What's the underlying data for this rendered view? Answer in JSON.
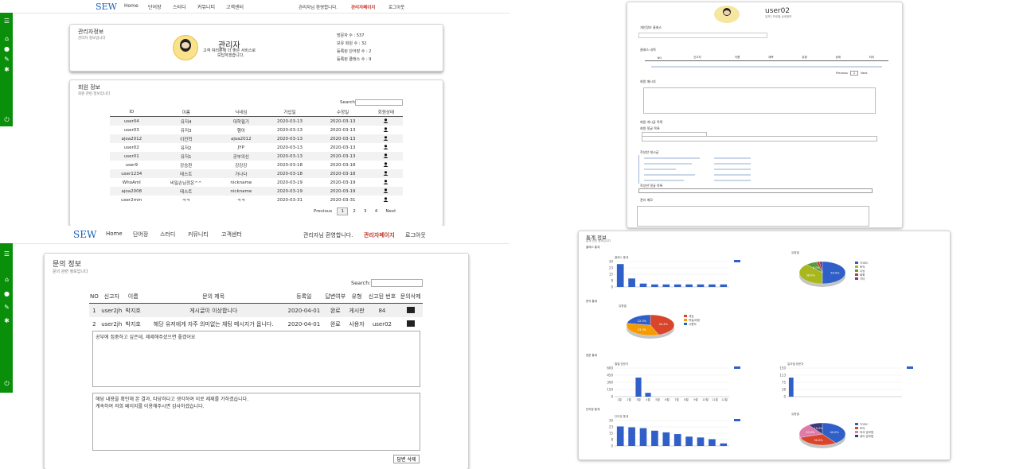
{
  "panel1": {
    "brand": "SEW",
    "nav": [
      "Home",
      "단어장",
      "스터디",
      "커뮤니티",
      "고객센터"
    ],
    "greeting": "관리자님 환영합니다.",
    "admin_link": "관리자페이지",
    "logout": "로그아웃",
    "admin_card": {
      "title": "관리자정보",
      "subtitle": "관리자 정보입니다",
      "name": "관리자",
      "message1": "고객 여러분께 더 좋은 서비스로",
      "message2": "보답하겠습니다.",
      "stats": [
        "방문자 수 : 537",
        "보유 회원 수 : 32",
        "등록된 단어장 수 : 2",
        "등록된 클래스 수 : 9"
      ]
    },
    "members": {
      "title": "회원 정보",
      "subtitle": "회원 관련 정보입니다",
      "search_label": "Search:",
      "columns": [
        "ID",
        "이름",
        "닉네임",
        "가입일",
        "수정일",
        "회원상태"
      ],
      "rows": [
        [
          "user04",
          "유저4",
          "대학필기",
          "2020-03-13",
          "2020-03-13"
        ],
        [
          "user03",
          "유저3",
          "행아",
          "2020-03-13",
          "2020-03-13"
        ],
        [
          "ajoa2012",
          "이진혁",
          "ajoa2012",
          "2020-03-13",
          "2020-03-13"
        ],
        [
          "user02",
          "유저2",
          "JYP",
          "2020-03-13",
          "2020-03-13"
        ],
        [
          "user01",
          "유저1",
          "공부의신",
          "2020-03-13",
          "2020-03-13"
        ],
        [
          "user9",
          "강승환",
          "강강강",
          "2020-03-18",
          "2020-03-18"
        ],
        [
          "user1234",
          "테스트",
          "가나다",
          "2020-03-18",
          "2020-03-18"
        ],
        [
          "WhoAmI",
          "비밀손님정온^^",
          "nickname",
          "2020-03-19",
          "2020-03-19"
        ],
        [
          "ajoa2008",
          "테스트",
          "nickname",
          "2020-03-19",
          "2020-03-19"
        ],
        [
          "user2mm",
          "ㅋㅋ",
          "ㅋㅋ",
          "2020-03-31",
          "2020-03-31"
        ]
      ],
      "pagination": [
        "Previous",
        "1",
        "2",
        "3",
        "4",
        "Next"
      ]
    }
  },
  "panel2": {
    "username": "user02",
    "user_sub": "유저2 프로필 상세정보",
    "sections": [
      "개인정보 클래스",
      "클래스 내역",
      "회원 메시지",
      "회원 게시글 목록",
      "회원 댓글 목록",
      "작성한 게시글",
      "작성한 댓글 목록",
      "관리 메모"
    ],
    "table_cols": [
      "NO",
      "신고자",
      "이름",
      "제목",
      "유형",
      "상태",
      "처리"
    ],
    "pager": [
      "Previous",
      "1",
      "Next"
    ]
  },
  "panel3": {
    "brand": "SEW",
    "nav": [
      "Home",
      "단어장",
      "스터디",
      "커뮤니티",
      "고객센터"
    ],
    "greeting": "관리자님 환영합니다.",
    "admin_link": "관리자페이지",
    "logout": "로그아웃",
    "inquiry": {
      "title": "문의 정보",
      "subtitle": "문의 관련 정보입니다",
      "search_label": "Search:",
      "columns": [
        "NO",
        "신고자",
        "이름",
        "문의 제목",
        "등록일",
        "답변여부",
        "유형",
        "신고된 번호",
        "문의삭제"
      ],
      "rows": [
        [
          "1",
          "user2jh",
          "박지호",
          "게시글이 이상합니다",
          "2020-04-01",
          "완료",
          "게시판",
          "84"
        ],
        [
          "2",
          "user2jh",
          "박지호",
          "해당 유저에게 자주 의미없는 채팅 메시지가 옵니다.",
          "2020-04-01",
          "완료",
          "사용자",
          "user02"
        ]
      ],
      "question_text": "공부에 집중하고 싶은데, 제제해주셨으면 좋겠어요",
      "answer_line1": "해당 내용을 확인해 본 결과, 타당하다고 생각하여 이로 제제를 가하겠습니다.",
      "answer_line2": "계속하여 저희 페이지를 이용해주시면 감사하겠습니다.",
      "delete_answer": "답변 삭제"
    }
  },
  "panel4": {
    "title": "통계 정보",
    "subtitle": "통계 관련 정보입니다",
    "sections": [
      "클래스 통계",
      "문의 통계",
      "방문 통계",
      "단어장 통계"
    ],
    "pie_title": "유형별",
    "legend_series": "클래스"
  },
  "chart_data": [
    {
      "type": "bar",
      "title": "클래스 통계",
      "values": [
        27,
        10,
        4,
        3,
        3,
        3,
        3,
        3,
        3,
        3
      ],
      "ylim": [
        0,
        30
      ]
    },
    {
      "type": "pie",
      "title": "유형별",
      "legend": [
        "TOEIC",
        "토익",
        "수능",
        "회화",
        "기타"
      ],
      "values": [
        50.0,
        38.0,
        8.0,
        2.0,
        2.0
      ],
      "colors": [
        "#2f5fc7",
        "#a8b81c",
        "#5a9a3a",
        "#c23a2a",
        "#6a3a8a"
      ]
    },
    {
      "type": "pie",
      "title": "유형별",
      "legend": [
        "게임",
        "욕설/비방",
        "사용자"
      ],
      "values": [
        44.4,
        33.3,
        22.3
      ],
      "colors": [
        "#d9452a",
        "#f59b00",
        "#2f5fc7"
      ]
    },
    {
      "type": "bar",
      "title": "월별 방문자",
      "categories": [
        "1월",
        "2월",
        "3월",
        "4월",
        "5월",
        "6월",
        "7월",
        "8월",
        "9월",
        "10월",
        "11월",
        "12월"
      ],
      "values": [
        0,
        0,
        400,
        80,
        0,
        0,
        0,
        0,
        0,
        0,
        0,
        0
      ],
      "ylim": [
        0,
        600
      ]
    },
    {
      "type": "bar",
      "title": "일자별 방문자",
      "values": [
        100,
        0,
        0,
        0,
        0,
        0,
        0,
        0,
        0,
        0,
        0,
        0,
        0,
        0,
        0
      ],
      "ylim": [
        0,
        150
      ]
    },
    {
      "type": "bar",
      "title": "단어장 통계",
      "values": [
        23,
        22,
        21,
        18,
        16,
        14,
        11,
        10,
        8,
        3
      ],
      "ylim": [
        0,
        30
      ]
    },
    {
      "type": "pie",
      "title": "유형별",
      "legend": [
        "TOEIC",
        "토익",
        "외국 공부법",
        "영어 공부법"
      ],
      "values": [
        40.0,
        30.0,
        20.0,
        10.0
      ],
      "colors": [
        "#2f5fc7",
        "#d9452a",
        "#e07aa8",
        "#3a3a7a"
      ]
    }
  ]
}
